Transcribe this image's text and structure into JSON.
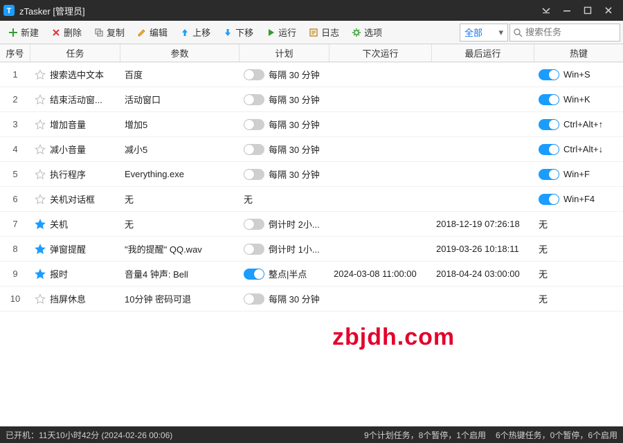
{
  "window": {
    "title": "zTasker [管理员]"
  },
  "toolbar": {
    "new": "新建",
    "delete": "删除",
    "copy": "复制",
    "edit": "编辑",
    "moveUp": "上移",
    "moveDown": "下移",
    "run": "运行",
    "log": "日志",
    "options": "选项"
  },
  "filter": {
    "selected": "全部"
  },
  "search": {
    "placeholder": "搜索任务"
  },
  "columns": {
    "idx": "序号",
    "task": "任务",
    "param": "参数",
    "plan": "计划",
    "next": "下次运行",
    "last": "最后运行",
    "hotkey": "热键"
  },
  "rows": [
    {
      "idx": "1",
      "starred": false,
      "task": "搜索选中文本",
      "param": "百度",
      "planOn": false,
      "plan": "每隔 30 分钟",
      "next": "",
      "last": "",
      "hotOn": true,
      "hotkey": "Win+S"
    },
    {
      "idx": "2",
      "starred": false,
      "task": "结束活动窗...",
      "param": "活动窗口",
      "planOn": false,
      "plan": "每隔 30 分钟",
      "next": "",
      "last": "",
      "hotOn": true,
      "hotkey": "Win+K"
    },
    {
      "idx": "3",
      "starred": false,
      "task": "增加音量",
      "param": "增加5",
      "planOn": false,
      "plan": "每隔 30 分钟",
      "next": "",
      "last": "",
      "hotOn": true,
      "hotkey": "Ctrl+Alt+↑"
    },
    {
      "idx": "4",
      "starred": false,
      "task": "减小音量",
      "param": "减小5",
      "planOn": false,
      "plan": "每隔 30 分钟",
      "next": "",
      "last": "",
      "hotOn": true,
      "hotkey": "Ctrl+Alt+↓"
    },
    {
      "idx": "5",
      "starred": false,
      "task": "执行程序",
      "param": "Everything.exe",
      "planOn": false,
      "plan": "每隔 30 分钟",
      "next": "",
      "last": "",
      "hotOn": true,
      "hotkey": "Win+F"
    },
    {
      "idx": "6",
      "starred": false,
      "task": "关机对话框",
      "param": "无",
      "planOn": null,
      "plan": "无",
      "next": "",
      "last": "",
      "hotOn": true,
      "hotkey": "Win+F4"
    },
    {
      "idx": "7",
      "starred": true,
      "task": "关机",
      "param": "无",
      "planOn": false,
      "plan": "倒计时 2小...",
      "next": "",
      "last": "2018-12-19 07:26:18",
      "hotOn": null,
      "hotkey": "无"
    },
    {
      "idx": "8",
      "starred": true,
      "task": "弹窗提醒",
      "param": "\"我的提醒\" QQ.wav",
      "planOn": false,
      "plan": "倒计时 1小...",
      "next": "",
      "last": "2019-03-26 10:18:11",
      "hotOn": null,
      "hotkey": "无"
    },
    {
      "idx": "9",
      "starred": true,
      "task": "报时",
      "param": "音量4 钟声: Bell",
      "planOn": true,
      "plan": "整点|半点",
      "next": "2024-03-08 11:00:00",
      "last": "2018-04-24 03:00:00",
      "hotOn": null,
      "hotkey": "无"
    },
    {
      "idx": "10",
      "starred": false,
      "task": "挡屏休息",
      "param": "10分钟 密码可退",
      "planOn": false,
      "plan": "每隔 30 分钟",
      "next": "",
      "last": "",
      "hotOn": null,
      "hotkey": "无"
    }
  ],
  "watermark": "zbjdh.com",
  "status": {
    "uptimeLabel": "已开机：",
    "uptime": "11天10小时42分 (2024-02-26 00:06)",
    "planSummary": "9个计划任务，8个暂停，1个启用",
    "hotkeySummary": "6个热键任务，0个暂停，6个启用"
  }
}
